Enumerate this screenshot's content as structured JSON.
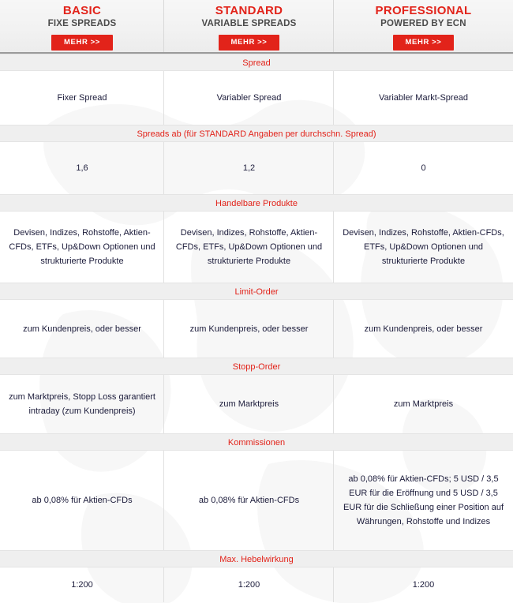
{
  "header": {
    "columns": [
      {
        "title": "BASIC",
        "subtitle": "FIXE SPREADS",
        "button": "MEHR >>"
      },
      {
        "title": "STANDARD",
        "subtitle": "VARIABLE SPREADS",
        "button": "MEHR >>"
      },
      {
        "title": "PROFESSIONAL",
        "subtitle": "POWERED BY ECN",
        "button": "MEHR >>"
      }
    ]
  },
  "colors": {
    "accent_red": "#e2231a",
    "band_background": "#efefef",
    "header_background": "#f2f2f2",
    "text_dark": "#1b1b3a",
    "subtitle_gray": "#4a4a4a"
  },
  "sections": [
    {
      "label": "Spread",
      "cells": [
        "Fixer Spread",
        "Variabler Spread",
        "Variabler Markt-Spread"
      ]
    },
    {
      "label": "Spreads ab (für STANDARD Angaben per durchschn. Spread)",
      "cells": [
        "1,6",
        "1,2",
        "0"
      ]
    },
    {
      "label": "Handelbare Produkte",
      "cells": [
        "Devisen, Indizes, Rohstoffe, Aktien-CFDs, ETFs, Up&Down Optionen und strukturierte Produkte",
        "Devisen, Indizes, Rohstoffe, Aktien-CFDs, ETFs, Up&Down Optionen und strukturierte Produkte",
        "Devisen, Indizes, Rohstoffe, Aktien-CFDs, ETFs, Up&Down Optionen und strukturierte Produkte"
      ]
    },
    {
      "label": "Limit-Order",
      "cells": [
        "zum Kundenpreis, oder besser",
        "zum Kundenpreis, oder besser",
        "zum Kundenpreis, oder besser"
      ]
    },
    {
      "label": "Stopp-Order",
      "cells": [
        "zum Marktpreis, Stopp Loss garantiert intraday (zum Kundenpreis)",
        "zum Marktpreis",
        "zum Marktpreis"
      ]
    },
    {
      "label": "Kommissionen",
      "cells": [
        "ab 0,08% für Aktien-CFDs",
        "ab 0,08% für Aktien-CFDs",
        "ab 0,08% für Aktien-CFDs; 5 USD / 3,5 EUR für die Eröffnung und 5 USD / 3,5 EUR für die Schließung einer Position auf Währungen, Rohstoffe und Indizes"
      ]
    },
    {
      "label": "Max. Hebelwirkung",
      "cells": [
        "1:200",
        "1:200",
        "1:200"
      ]
    }
  ]
}
